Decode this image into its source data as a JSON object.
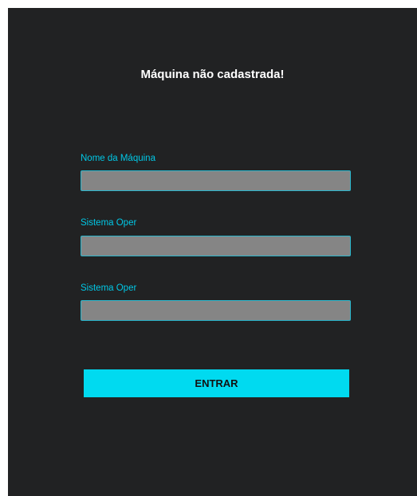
{
  "title": "Máquina não cadastrada!",
  "fields": [
    {
      "label": "Nome da Máquina",
      "value": "",
      "placeholder": ""
    },
    {
      "label": "Sistema Oper",
      "value": "",
      "placeholder": ""
    },
    {
      "label": "Sistema Oper",
      "value": "",
      "placeholder": ""
    }
  ],
  "submit_label": "ENTRAR",
  "colors": {
    "background": "#212223",
    "accent": "#00daf0",
    "label": "#00c8e6",
    "input_fill": "#858585"
  }
}
